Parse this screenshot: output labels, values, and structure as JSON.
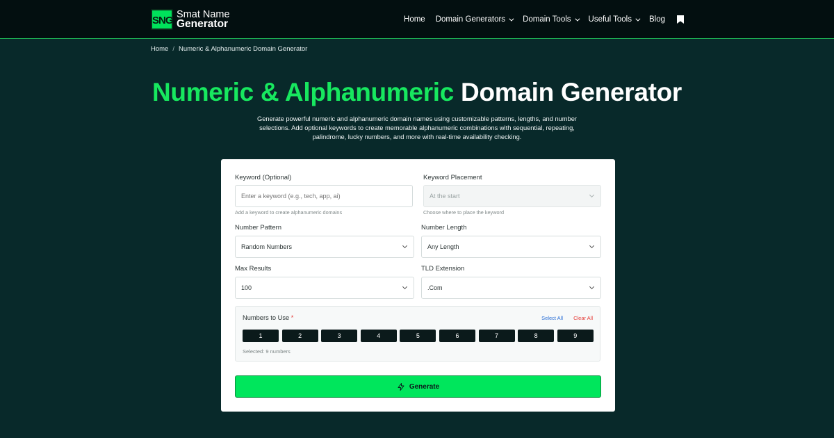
{
  "header": {
    "logo_badge": "SNG",
    "logo_line1": "Smat Name",
    "logo_line2": "Generator",
    "nav": [
      {
        "label": "Home",
        "dropdown": false
      },
      {
        "label": "Domain Generators",
        "dropdown": true
      },
      {
        "label": "Domain Tools",
        "dropdown": true
      },
      {
        "label": "Useful Tools",
        "dropdown": true
      },
      {
        "label": "Blog",
        "dropdown": false
      }
    ],
    "bookmark_icon": "bookmark-icon"
  },
  "breadcrumb": {
    "home": "Home",
    "separator": "/",
    "current": "Numeric & Alphanumeric Domain Generator"
  },
  "hero": {
    "title_green": "Numeric & Alphanumeric",
    "title_white": "Domain Generator",
    "subtitle": "Generate powerful numeric and alphanumeric domain names using customizable patterns, lengths, and number selections. Add optional keywords to create memorable alphanumeric combinations with sequential, repeating, palindrome, lucky numbers, and more with real-time availability checking."
  },
  "form": {
    "keyword": {
      "label": "Keyword (Optional)",
      "placeholder": "Enter a keyword (e.g., tech, app, ai)",
      "help": "Add a keyword to create alphanumeric domains"
    },
    "keyword_placement": {
      "label": "Keyword Placement",
      "value": "At the start",
      "help": "Choose where to place the keyword"
    },
    "number_pattern": {
      "label": "Number Pattern",
      "value": "Random Numbers"
    },
    "number_length": {
      "label": "Number Length",
      "value": "Any Length"
    },
    "max_results": {
      "label": "Max Results",
      "value": "100"
    },
    "tld_extension": {
      "label": "TLD Extension",
      "value": ".Com"
    },
    "numbers": {
      "label": "Numbers to Use",
      "required_mark": "*",
      "select_all": "Select All",
      "clear_all": "Clear All",
      "digits": [
        "1",
        "2",
        "3",
        "4",
        "5",
        "6",
        "7",
        "8",
        "9"
      ],
      "selected_text": "Selected: 9 numbers"
    },
    "generate_label": "Generate",
    "generate_icon": "bolt-icon"
  },
  "colors": {
    "page_bg": "#08292a",
    "header_bg": "#030f10",
    "accent_green": "#00e65c",
    "title_green": "#17e85f",
    "number_button": "#0b1a1b",
    "link_blue": "#2a6fd6",
    "danger_red": "#e53935"
  }
}
